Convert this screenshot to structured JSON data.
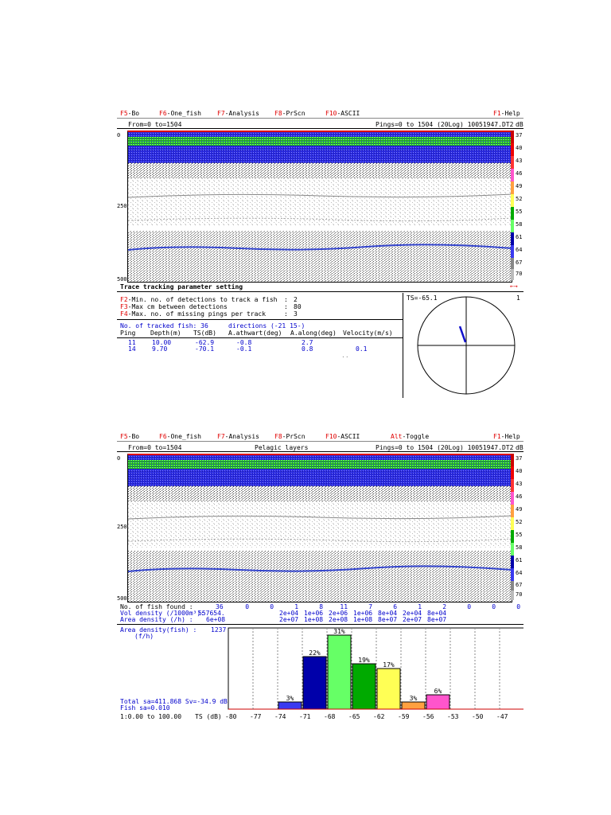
{
  "fkeys": {
    "f5": {
      "key": "F5",
      "label": "-Bo"
    },
    "f6": {
      "key": "F6",
      "label": "-One_fish"
    },
    "f7": {
      "key": "F7",
      "label": "-Analysis"
    },
    "f8": {
      "key": "F8",
      "label": "-PrScn"
    },
    "f10": {
      "key": "F10",
      "label": "-ASCII"
    },
    "alt": {
      "key": "Alt",
      "label": "-Toggle"
    },
    "f1": {
      "key": "F1",
      "label": "-Help"
    }
  },
  "top": {
    "from_to": "From=0 to=1504",
    "pings": "Pings=0 to 1504 (20Log) 10051947.DT2",
    "unit": "dB",
    "depth_ticks": [
      "0",
      "250",
      "500"
    ],
    "color_scale": [
      "37",
      "40",
      "43",
      "46",
      "49",
      "52",
      "55",
      "58",
      "61",
      "64",
      "67",
      "70"
    ],
    "panel_title": "Trace tracking parameter setting",
    "arrows": "←→",
    "params": [
      {
        "key": "F2",
        "label": "-Min. no. of detections to track a fish",
        "sep": ":",
        "value": "2"
      },
      {
        "key": "F3",
        "label": "-Max cm between detections",
        "sep": ":",
        "value": "80"
      },
      {
        "key": "F4",
        "label": "-Max. no. of missing pings per track",
        "sep": ":",
        "value": "3"
      }
    ],
    "tracked": "No. of tracked fish: 36",
    "directions": "directions (-21    15-)",
    "table_headers": [
      "Ping",
      "Depth(m)",
      "TS(dB)",
      "A.athwart(deg)",
      "A.along(deg)",
      "Velocity(m/s)"
    ],
    "table_rows": [
      [
        "11",
        "10.00",
        "-62.9",
        "-0.8",
        "2.7",
        ""
      ],
      [
        "14",
        "9.70",
        "-70.1",
        "-0.1",
        "0.8",
        "0.1"
      ]
    ],
    "ts_label": "TS=-65.1",
    "ts_right": "1",
    "marker": ".."
  },
  "bottom": {
    "from_to": "From=0 to=1504",
    "center": "Pelagic layers",
    "pings": "Pings=0 to 1504 (20Log) 10051947.DT2",
    "unit": "dB",
    "depth_ticks": [
      "0",
      "250",
      "500"
    ],
    "color_scale": [
      "37",
      "40",
      "43",
      "46",
      "49",
      "52",
      "55",
      "58",
      "61",
      "64",
      "67",
      "70"
    ],
    "stats_labels": {
      "fish_found": "No. of fish found   :",
      "vol_density": "Vol density (/1000m³):",
      "area_density": "Area density (/h)   :",
      "area_density_fish": "Area density(fish) :",
      "area_unit": "(f/h)"
    },
    "fish_found_total": "36",
    "vol_density_total": "557654.",
    "area_density_total": "6e+08",
    "area_fish_total": "1237",
    "fish_counts": [
      "0",
      "0",
      "1",
      "8",
      "11",
      "7",
      "6",
      "1",
      "2",
      "0",
      "0",
      "0"
    ],
    "vol_row": [
      "",
      "",
      "2e+04",
      "1e+06",
      "2e+06",
      "1e+06",
      "8e+04",
      "2e+04",
      "8e+04",
      "",
      "",
      ""
    ],
    "area_row": [
      "",
      "",
      "2e+07",
      "1e+08",
      "2e+08",
      "1e+08",
      "8e+07",
      "2e+07",
      "8e+07",
      "",
      "",
      ""
    ],
    "total_line": "Total sa=411.868  Sv=-34.9 dB",
    "fish_line": "Fish  sa=0.010",
    "range_label": "1:0.00 to 100.00",
    "ts_axis_label": "TS (dB)",
    "x_ticks": [
      "-80",
      "-77",
      "-74",
      "-71",
      "-68",
      "-65",
      "-62",
      "-59",
      "-56",
      "-53",
      "-50",
      "-47"
    ]
  },
  "chart_data": {
    "type": "bar",
    "xlabel": "TS (dB)",
    "categories": [
      "-80",
      "-77",
      "-74",
      "-71",
      "-68",
      "-65",
      "-62",
      "-59",
      "-56",
      "-53",
      "-50",
      "-47"
    ],
    "values": [
      0,
      0,
      3,
      22,
      31,
      19,
      17,
      3,
      6,
      0,
      0,
      0
    ],
    "value_labels": [
      "",
      "",
      "3%",
      "22%",
      "31%",
      "19%",
      "17%",
      "3%",
      "6%",
      "",
      "",
      ""
    ],
    "bar_colors": [
      "#000000",
      "#000000",
      "#3a3af0",
      "#0000aa",
      "#66ff66",
      "#00aa00",
      "#ffff55",
      "#ffa040",
      "#ff55cc",
      "#000000",
      "#000000",
      "#000000"
    ],
    "ylim": [
      0,
      34
    ]
  },
  "colors": {
    "fkey": "#e00000",
    "value": "#0000cc",
    "green_echo": "#33ee33",
    "blue_echo": "#2233dd"
  }
}
